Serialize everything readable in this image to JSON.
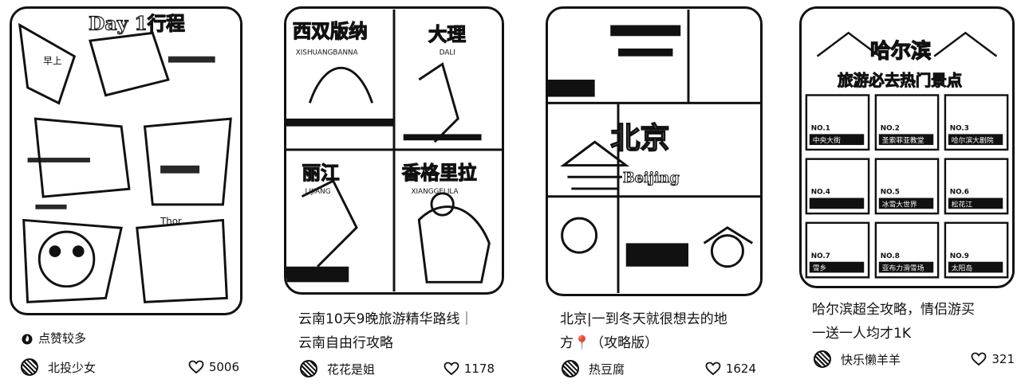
{
  "cards": [
    {
      "thumb_text": [
        "Day 1行程",
        "早上",
        "Thor"
      ],
      "hot_label": "点赞较多",
      "author": "北投少女",
      "likes": "5006"
    },
    {
      "thumb_text": [
        "西双版纳",
        "大理",
        "丽江",
        "香格里拉",
        "XISHUANGBANNA",
        "DALI",
        "LIJIANG",
        "XIANGGELILA"
      ],
      "title_line1": "云南10天9晚旅游精华路线｜",
      "title_line2": "云南自由行攻略",
      "author": "花花是姐",
      "likes": "1178"
    },
    {
      "thumb_text": [
        "北京",
        "Beijing"
      ],
      "title_line1": "北京|一到冬天就很想去的地",
      "title_line2": "方📍（攻略版）",
      "author": "热豆腐",
      "likes": "1624"
    },
    {
      "thumb_text": [
        "哈尔滨",
        "旅游必去热门景点",
        "NO.1",
        "NO.2",
        "NO.3",
        "NO.4",
        "NO.5",
        "NO.6",
        "NO.7",
        "NO.8",
        "NO.9",
        "中央大街",
        "圣索菲亚教堂",
        "哈尔滨大剧院",
        "冰雪大世界",
        "松花江",
        "雪乡",
        "亚布力滑雪场",
        "太阳岛"
      ],
      "title_line1": "哈尔滨超全攻略，情侣游买",
      "title_line2": "一送一人均才1K",
      "author": "快乐懒羊羊",
      "likes": "321"
    }
  ],
  "icons": {
    "flame": "flame-icon",
    "heart": "heart-icon",
    "pin": "map-pin-icon"
  }
}
